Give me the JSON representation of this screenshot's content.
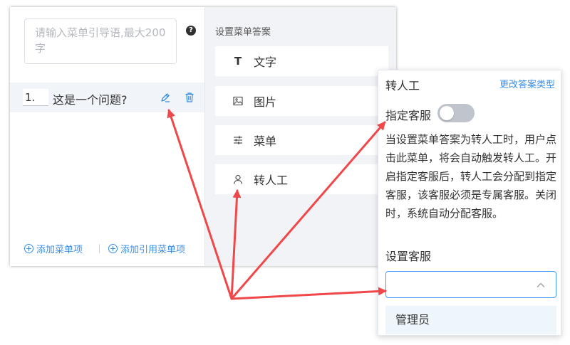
{
  "left_panel": {
    "guide_placeholder": "请输入菜单引导语,最大200字",
    "help_icon_glyph": "?",
    "menu_item": {
      "index": "1.",
      "question": "这是一个问题?"
    },
    "add_item_label": "添加菜单项",
    "add_ref_label": "添加引用菜单项"
  },
  "right_panel": {
    "title": "设置菜单答案",
    "options": [
      {
        "label": "文字",
        "icon": "text-icon",
        "glyph": "T"
      },
      {
        "label": "图片",
        "icon": "image-icon"
      },
      {
        "label": "菜单",
        "icon": "sliders-icon"
      },
      {
        "label": "转人工",
        "icon": "user-icon"
      }
    ]
  },
  "popover": {
    "title": "转人工",
    "change_type_link": "更改答案类型",
    "assign_label": "指定客服",
    "assign_enabled": false,
    "description": "当设置菜单答案为转人工时，用户点击此菜单，将会自动触发转人工。开启指定客服后，转人工会分配到指定客服，该客服必须是专属客服。关闭时，系统自动分配客服。",
    "set_agent_label": "设置客服",
    "select_value": "",
    "dropdown_option": "管理员"
  },
  "colors": {
    "accent": "#3a8ee6",
    "arrow": "#f0484a",
    "panel_bg": "#f2f3f6"
  }
}
